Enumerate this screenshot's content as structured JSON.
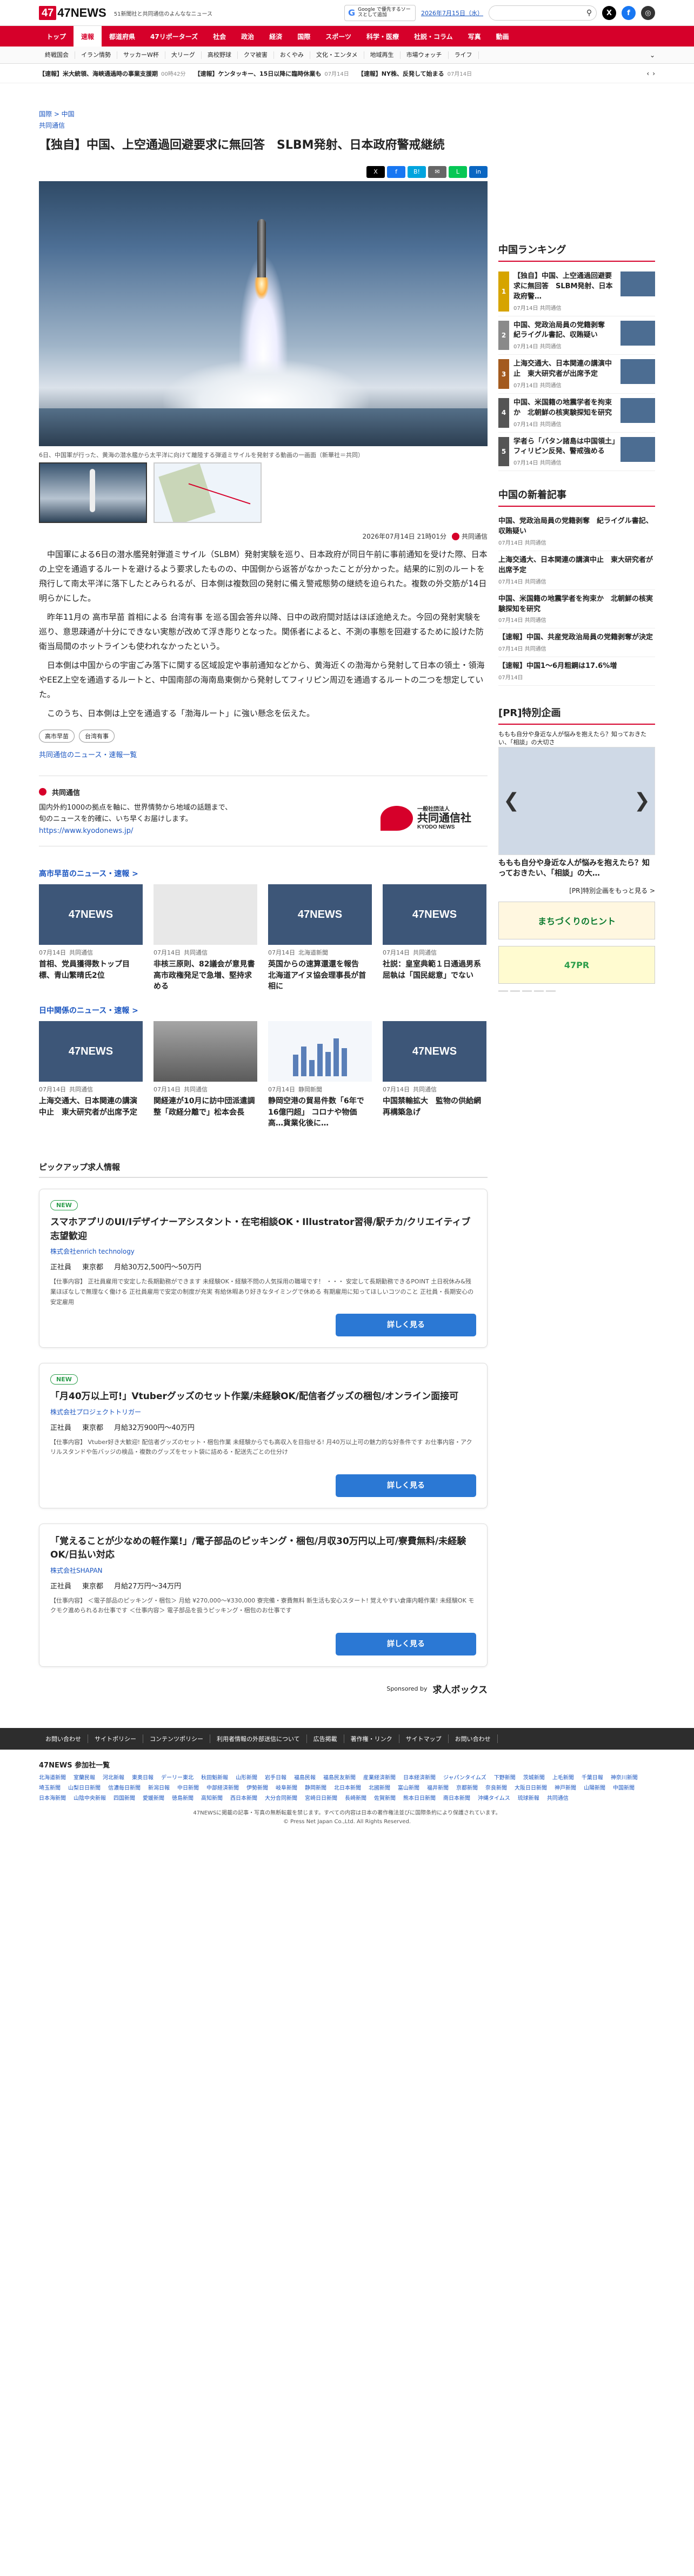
{
  "header": {
    "logo": "47NEWS",
    "tagline": "51新聞社と共同通信のよんななニュース",
    "google_btn": "Google で優先するソースとして追加",
    "date": "2026年7月15日（水）",
    "search_placeholder": "",
    "sns": [
      "X",
      "f",
      "◎"
    ]
  },
  "nav": [
    "トップ",
    "速報",
    "都道府県",
    "47リポーターズ",
    "社会",
    "政治",
    "経済",
    "国際",
    "スポーツ",
    "科学・医療",
    "社説・コラム",
    "写真",
    "動画"
  ],
  "nav_active": "速報",
  "subnav": [
    "終戦国会",
    "イラン情勢",
    "サッカーW杯",
    "大リーグ",
    "高校野球",
    "クマ被害",
    "おくやみ",
    "文化・エンタメ",
    "地域再生",
    "市場ウォッチ",
    "ライフ"
  ],
  "ticker": [
    {
      "text": "【速報】米大統領、海峡通過時の事業支援期",
      "time": "00時42分"
    },
    {
      "text": "【速報】ケンタッキー、15日以降に臨時休業も",
      "time": "07月14日"
    },
    {
      "text": "【速報】NY株、反発して始まる",
      "time": "07月14日"
    }
  ],
  "article": {
    "breadcrumb": "国際 > 中国",
    "source": "共同通信",
    "title": "【独自】中国、上空通過回避要求に無回答　SLBM発射、日本政府警戒継続",
    "share": [
      "X",
      "f",
      "B!",
      "✉",
      "L",
      "in"
    ],
    "caption": "6日、中国軍が行った、黄海の潜水艦から太平洋に向けて離陸する弾道ミサイルを発射する動画の一画面（新華社＝共同）",
    "datetime": "2026年07月14日 21時01分",
    "publisher": "共同通信",
    "paragraphs": [
      "中国軍による6日の潜水艦発射弾道ミサイル（SLBM）発射実験を巡り、日本政府が同日午前に事前通知を受けた際、日本の上空を通過するルートを避けるよう要求したものの、中国側から返答がなかったことが分かった。結果的に別のルートを飛行して南太平洋に落下したとみられるが、日本側は複数回の発射に備え警戒態勢の継続を迫られた。複数の外交筋が14日明らかにした。",
      "昨年11月の 高市早苗 首相による 台湾有事 を巡る国会答弁以降、日中の政府間対話はほぼ途絶えた。今回の発射実験を巡り、意思疎通が十分にできない実態が改めて浮き彫りとなった。関係者によると、不測の事態を回避するために設けた防衛当局間のホットラインも使われなかったという。",
      "日本側は中国からの宇宙ごみ落下に関する区域設定や事前通知などから、黄海近くの渤海から発射して日本の領土・領海やEEZ上空を通過するルートと、中国南部の海南島東側から発射してフィリピン周辺を通過するルートの二つを想定していた。",
      "このうち、日本側は上空を通過する「渤海ルート」に強い懸念を伝えた。"
    ],
    "tags": [
      "高市早苗",
      "台湾有事"
    ],
    "more": "共同通信のニュース・速報一覧"
  },
  "provider": {
    "name": "共同通信",
    "desc": "国内外約1000の拠点を軸に、世界情勢から地域の話題まで、旬のニュースを的確に、いち早くお届けします。",
    "url": "https://www.kyodonews.jp/",
    "logo_small": "一般社団法人",
    "logo_big": "共同通信社",
    "logo_en": "KYODO NEWS"
  },
  "section1": {
    "head": "高市早苗のニュース・速報 >",
    "cards": [
      {
        "date": "07月14日",
        "src": "共同通信",
        "title": "首相、党員獲得数トップ目標、青山繁晴氏2位"
      },
      {
        "date": "07月14日",
        "src": "共同通信",
        "title": "非核三原則、82議会が意見書　高市政権発足で急増、堅持求める"
      },
      {
        "date": "07月14日",
        "src": "北海道新聞",
        "title": "英国からの速算還還を報告　北海道アイヌ協会理事長が首相に"
      },
      {
        "date": "07月14日",
        "src": "共同通信",
        "title": "社説：皇室典範１日通過男系屈執は「国民総意」でない"
      }
    ]
  },
  "section2": {
    "head": "日中関係のニュース・速報 >",
    "cards": [
      {
        "date": "07月14日",
        "src": "共同通信",
        "title": "上海交通大、日本関連の講演中止　東大研究者が出席予定"
      },
      {
        "date": "07月14日",
        "src": "共同通信",
        "title": "関経連が10月に訪中団派遣調整「政経分離で」松本会長"
      },
      {
        "date": "07月14日",
        "src": "静岡新聞",
        "title": "静岡空港の貿易件数「6年で16億円超」 コロナや物価高…貨業化後に…"
      },
      {
        "date": "07月14日",
        "src": "共同通信",
        "title": "中国禁輸拡大　監物の供給網再構築急げ"
      }
    ]
  },
  "jobs": {
    "head": "ピックアップ求人情報",
    "items": [
      {
        "badge": "NEW",
        "title": "スマホアプリのUI/Iデザイナーアシスタント・在宅相談OK・Illustrator習得/駅チカ/クリエイティブ志望歓迎",
        "company": "株式会社enrich technology",
        "type": "正社員",
        "loc": "東京都",
        "pay": "月給30万2,500円〜50万円",
        "desc": "【仕事内容】 正社員雇用で安定した長期勤務ができます 未経験OK・経験不問の人気採用の職場です！ ・・・ 安定して長期勤務できるPOINT 土日祝休み&残業ほぼなしで無理なく働ける 正社員雇用で安定の制度が充実 有給休暇あり好きなタイミングで休める 有期雇用に知ってほしいコツのこと 正社員・長期安心の安定雇用"
      },
      {
        "badge": "NEW",
        "title": "「月40万以上可!」Vtuberグッズのセット作業/未経験OK/配信者グッズの梱包/オンライン面接可",
        "company": "株式会社プロジェクトトリガー",
        "type": "正社員",
        "loc": "東京都",
        "pay": "月給32万900円〜40万円",
        "desc": "【仕事内容】 Vtuber好き大歓迎! 配信者グッズのセット・梱包作業 未経験からでも高収入を目指せる! 月40万以上可の魅力的な好条件です お仕事内容・アクリルスタンドや缶バッジの検品・複数のグッズをセット袋に詰める・配送先ごとの仕分け"
      },
      {
        "badge": "",
        "title": "「覚えることが少なめの軽作業!」/電子部品のピッキング・梱包/月収30万円以上可/寮費無料/未経験OK/日払い対応",
        "company": "株式会社SHAPAN",
        "type": "正社員",
        "loc": "東京都",
        "pay": "月給27万円〜34万円",
        "desc": "【仕事内容】 ＜電子部品のピッキング・梱包＞ 月給 ¥270,000〜¥330,000 寮完備・寮費無料 新生活も安心スタート! 覚えやすい倉庫内軽作業! 未経験OK モクモク進められるお仕事です ＜仕事内容＞ 電子部品を扱うピッキング・梱包のお仕事です"
      }
    ],
    "btn": "詳しく見る",
    "sponsored": "Sponsored by",
    "sponsor": "求人ボックス"
  },
  "sidebar": {
    "ranking_head": "中国ランキング",
    "ranking": [
      {
        "no": "1",
        "title": "【独自】中国、上空通過回避要求に無回答　SLBM発射、日本政府警…",
        "time": "07月14日",
        "src": "共同通信",
        "color": "#d6a400"
      },
      {
        "no": "2",
        "title": "中国、党政治局員の党籍剥奪　紀ライグル書記、収賄疑い",
        "time": "07月14日",
        "src": "共同通信",
        "color": "#8a8a8a"
      },
      {
        "no": "3",
        "title": "上海交通大、日本関連の講演中止　東大研究者が出席予定",
        "time": "07月14日",
        "src": "共同通信",
        "color": "#a35a1f"
      },
      {
        "no": "4",
        "title": "中国、米国籍の地震学者を拘束か　北朝鮮の核実験探知を研究",
        "time": "07月14日",
        "src": "共同通信",
        "color": "#555"
      },
      {
        "no": "5",
        "title": "学者ら「バタン諸島は中国領土」　フィリピン反発、警戒強める",
        "time": "07月14日",
        "src": "共同通信",
        "color": "#555"
      }
    ],
    "new_head": "中国の新着記事",
    "new_items": [
      {
        "title": "中国、党政治局員の党籍剥奪　紀ライグル書記、収賄疑い",
        "time": "07月14日",
        "src": "共同通信"
      },
      {
        "title": "上海交通大、日本関連の講演中止　東大研究者が出席予定",
        "time": "07月14日",
        "src": "共同通信"
      },
      {
        "title": "中国、米国籍の地震学者を拘束か　北朝鮮の核実験探知を研究",
        "time": "07月14日",
        "src": "共同通信"
      },
      {
        "title": "【速報】中国、共産党政治局員の党籍剥奪が決定",
        "time": "07月14日",
        "src": "共同通信"
      },
      {
        "title": "【速報】中国1〜6月粗鋼は17.6%増",
        "time": "07月14日",
        "src": ""
      }
    ],
    "promo_head": "[PR]特別企画",
    "promo_caption": "ももも自分や身近な人が悩みを抱えたら？知っておきたい、「相談」の大切さ",
    "promo_title": "ももも自分や身近な人が悩みを抱えたら？知っておきたい、「相談」の大…",
    "promo_link": "[PR]特別企画をもっと見る >",
    "ad1": "まちづくりのヒント",
    "ad2": "47PR"
  },
  "footer": {
    "nav": [
      "お問い合わせ",
      "サイトポリシー",
      "コンテンツポリシー",
      "利用者情報の外部送信について",
      "広告掲載",
      "著作権・リンク",
      "サイトマップ",
      "お問い合わせ"
    ],
    "links_head": "47NEWS 参加社一覧",
    "links": [
      "北海道新聞",
      "室蘭民報",
      "河北新報",
      "東奥日報",
      "デーリー東北",
      "秋田魁新報",
      "山形新聞",
      "岩手日報",
      "福島民報",
      "福島民友新聞",
      "産業経済新聞",
      "日本経済新聞",
      "ジャパンタイムズ",
      "下野新聞",
      "茨城新聞",
      "上毛新聞",
      "千葉日報",
      "神奈川新聞",
      "埼玉新聞",
      "山梨日日新聞",
      "信濃毎日新聞",
      "新潟日報",
      "中日新聞",
      "中部経済新聞",
      "伊勢新聞",
      "岐阜新聞",
      "静岡新聞",
      "北日本新聞",
      "北國新聞",
      "富山新聞",
      "福井新聞",
      "京都新聞",
      "奈良新聞",
      "大阪日日新聞",
      "神戸新聞",
      "山陽新聞",
      "中国新聞",
      "日本海新聞",
      "山陰中央新報",
      "四国新聞",
      "愛媛新聞",
      "徳島新聞",
      "高知新聞",
      "西日本新聞",
      "大分合同新聞",
      "宮崎日日新聞",
      "長崎新聞",
      "佐賀新聞",
      "熊本日日新聞",
      "南日本新聞",
      "沖縄タイムス",
      "琉球新報",
      "共同通信"
    ],
    "copy1": "47NEWSに掲載の記事・写真の無断転載を禁じます。すべての内容は日本の著作権法並びに国際条約により保護されています。",
    "copy2": "© Press Net Japan Co.,Ltd. All Rights Reserved."
  }
}
